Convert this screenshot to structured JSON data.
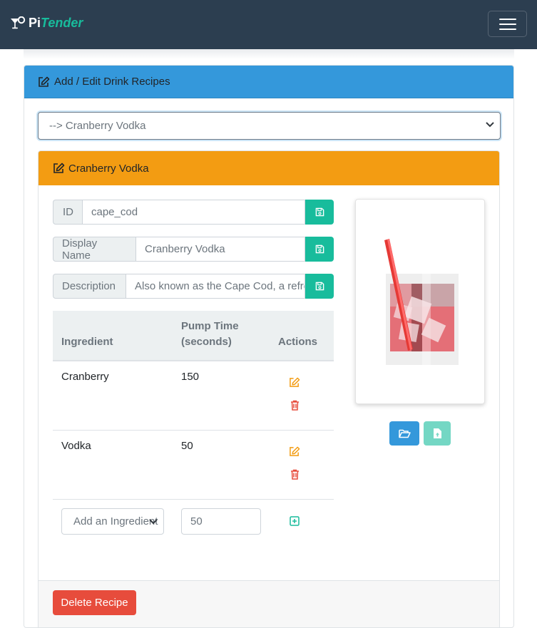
{
  "navbar": {
    "brand_pi": "Pi",
    "brand_tender": "Tender"
  },
  "main_card": {
    "title": "Add / Edit Drink Recipes",
    "selected_recipe": "--> Cranberry Vodka"
  },
  "recipe": {
    "header": "Cranberry Vodka",
    "id_label": "ID",
    "id_value": "cape_cod",
    "display_name_label": "Display Name",
    "display_name_value": "Cranberry Vodka",
    "description_label": "Description",
    "description_value": "Also known as the Cape Cod, a refre"
  },
  "table": {
    "headers": {
      "ingredient": "Ingredient",
      "pump_time": "Pump Time (seconds)",
      "actions": "Actions"
    },
    "rows": [
      {
        "ingredient": "Cranberry",
        "pump_time": "150"
      },
      {
        "ingredient": "Vodka",
        "pump_time": "50"
      }
    ],
    "add_row": {
      "ingredient_placeholder": "Add an Ingredient",
      "pump_time_value": "50"
    }
  },
  "footer": {
    "delete_label": "Delete Recipe"
  },
  "colors": {
    "navbar": "#2c3e50",
    "primary": "#3498db",
    "warning": "#f39c12",
    "success": "#18bc9c",
    "danger": "#e74c3c"
  },
  "icons": [
    "cocktail-icon",
    "menu-icon",
    "edit-icon",
    "save-icon",
    "trash-icon",
    "plus-square-icon",
    "folder-open-icon",
    "file-upload-icon"
  ]
}
